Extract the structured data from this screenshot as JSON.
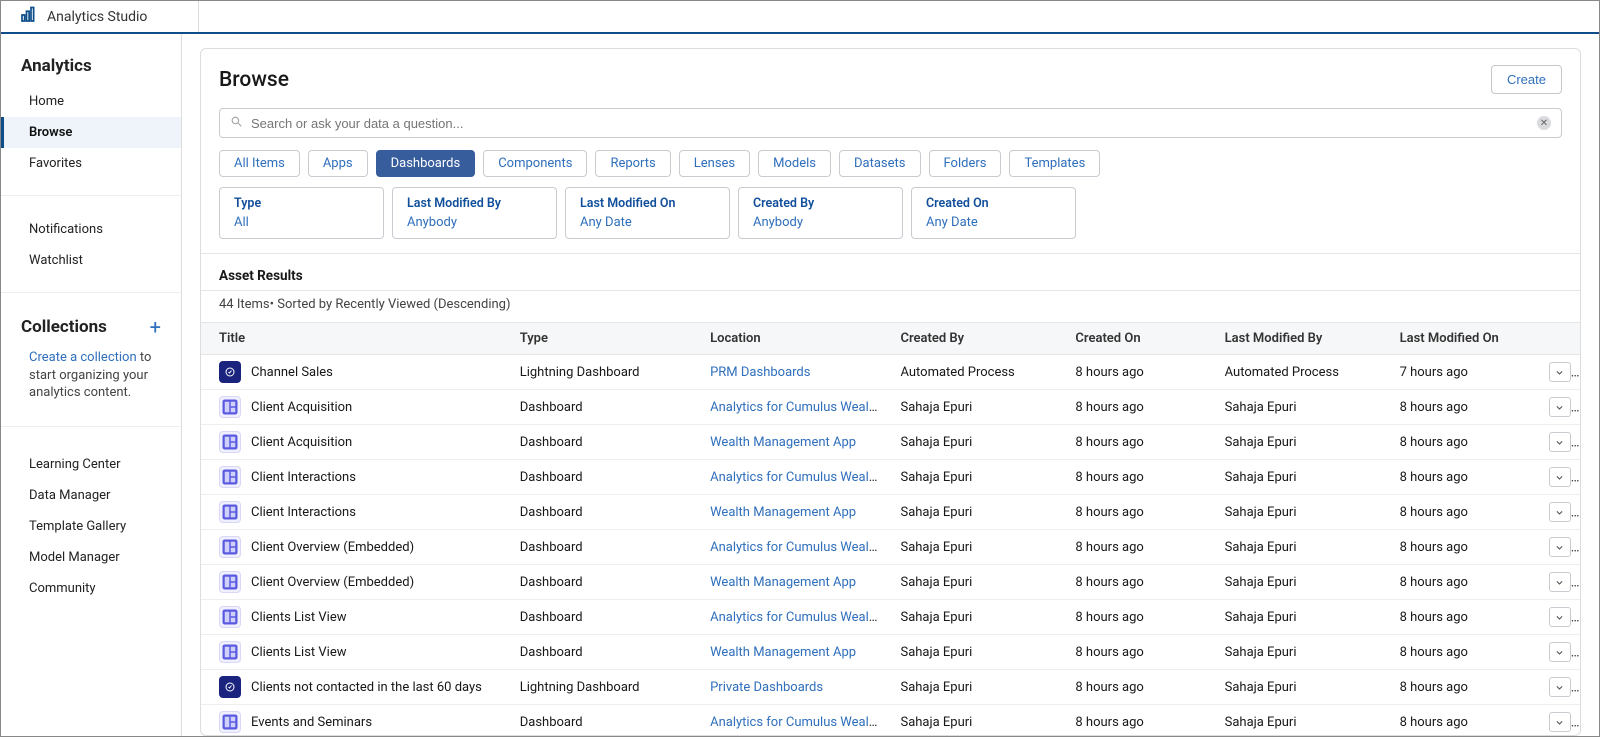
{
  "app": {
    "title": "Analytics Studio"
  },
  "sidebar": {
    "analytics_header": "Analytics",
    "items": [
      {
        "label": "Home"
      },
      {
        "label": "Browse"
      },
      {
        "label": "Favorites"
      }
    ],
    "secondary": [
      {
        "label": "Notifications"
      },
      {
        "label": "Watchlist"
      }
    ],
    "collections_header": "Collections",
    "collections_link": "Create a collection",
    "collections_desc": " to start organizing your analytics content.",
    "tertiary": [
      {
        "label": "Learning Center"
      },
      {
        "label": "Data Manager"
      },
      {
        "label": "Template Gallery"
      },
      {
        "label": "Model Manager"
      },
      {
        "label": "Community"
      }
    ]
  },
  "page": {
    "title": "Browse",
    "create_btn": "Create",
    "search_placeholder": "Search or ask your data a question...",
    "filter_pills": [
      "All Items",
      "Apps",
      "Dashboards",
      "Components",
      "Reports",
      "Lenses",
      "Models",
      "Datasets",
      "Folders",
      "Templates"
    ],
    "active_pill_index": 2,
    "facets": [
      {
        "label": "Type",
        "value": "All"
      },
      {
        "label": "Last Modified By",
        "value": "Anybody"
      },
      {
        "label": "Last Modified On",
        "value": "Any Date"
      },
      {
        "label": "Created By",
        "value": "Anybody"
      },
      {
        "label": "Created On",
        "value": "Any Date"
      }
    ],
    "results_header": "Asset Results",
    "results_sub": "44 Items• Sorted by Recently Viewed (Descending)",
    "columns": [
      "Title",
      "Type",
      "Location",
      "Created By",
      "Created On",
      "Last Modified By",
      "Last Modified On"
    ],
    "rows": [
      {
        "icon": "lightning",
        "title": "Channel Sales",
        "type": "Lightning Dashboard",
        "location": "PRM Dashboards",
        "createdBy": "Automated Process",
        "createdOn": "8 hours ago",
        "lmBy": "Automated Process",
        "lmOn": "7 hours ago"
      },
      {
        "icon": "dash",
        "title": "Client Acquisition",
        "type": "Dashboard",
        "location": "Analytics for Cumulus Wealt...",
        "createdBy": "Sahaja Epuri",
        "createdOn": "8 hours ago",
        "lmBy": "Sahaja Epuri",
        "lmOn": "8 hours ago"
      },
      {
        "icon": "dash",
        "title": "Client Acquisition",
        "type": "Dashboard",
        "location": "Wealth Management App",
        "createdBy": "Sahaja Epuri",
        "createdOn": "8 hours ago",
        "lmBy": "Sahaja Epuri",
        "lmOn": "8 hours ago"
      },
      {
        "icon": "dash",
        "title": "Client Interactions",
        "type": "Dashboard",
        "location": "Analytics for Cumulus Wealt...",
        "createdBy": "Sahaja Epuri",
        "createdOn": "8 hours ago",
        "lmBy": "Sahaja Epuri",
        "lmOn": "8 hours ago"
      },
      {
        "icon": "dash",
        "title": "Client Interactions",
        "type": "Dashboard",
        "location": "Wealth Management App",
        "createdBy": "Sahaja Epuri",
        "createdOn": "8 hours ago",
        "lmBy": "Sahaja Epuri",
        "lmOn": "8 hours ago"
      },
      {
        "icon": "dash",
        "title": "Client Overview (Embedded)",
        "type": "Dashboard",
        "location": "Analytics for Cumulus Wealt...",
        "createdBy": "Sahaja Epuri",
        "createdOn": "8 hours ago",
        "lmBy": "Sahaja Epuri",
        "lmOn": "8 hours ago"
      },
      {
        "icon": "dash",
        "title": "Client Overview (Embedded)",
        "type": "Dashboard",
        "location": "Wealth Management App",
        "createdBy": "Sahaja Epuri",
        "createdOn": "8 hours ago",
        "lmBy": "Sahaja Epuri",
        "lmOn": "8 hours ago"
      },
      {
        "icon": "dash",
        "title": "Clients List View",
        "type": "Dashboard",
        "location": "Analytics for Cumulus Wealt...",
        "createdBy": "Sahaja Epuri",
        "createdOn": "8 hours ago",
        "lmBy": "Sahaja Epuri",
        "lmOn": "8 hours ago"
      },
      {
        "icon": "dash",
        "title": "Clients List View",
        "type": "Dashboard",
        "location": "Wealth Management App",
        "createdBy": "Sahaja Epuri",
        "createdOn": "8 hours ago",
        "lmBy": "Sahaja Epuri",
        "lmOn": "8 hours ago"
      },
      {
        "icon": "lightning",
        "title": "Clients not contacted in the last 60 days",
        "type": "Lightning Dashboard",
        "location": "Private Dashboards",
        "createdBy": "Sahaja Epuri",
        "createdOn": "8 hours ago",
        "lmBy": "Sahaja Epuri",
        "lmOn": "8 hours ago"
      },
      {
        "icon": "dash",
        "title": "Events and Seminars",
        "type": "Dashboard",
        "location": "Analytics for Cumulus Wealt...",
        "createdBy": "Sahaja Epuri",
        "createdOn": "8 hours ago",
        "lmBy": "Sahaja Epuri",
        "lmOn": "8 hours ago"
      }
    ]
  }
}
